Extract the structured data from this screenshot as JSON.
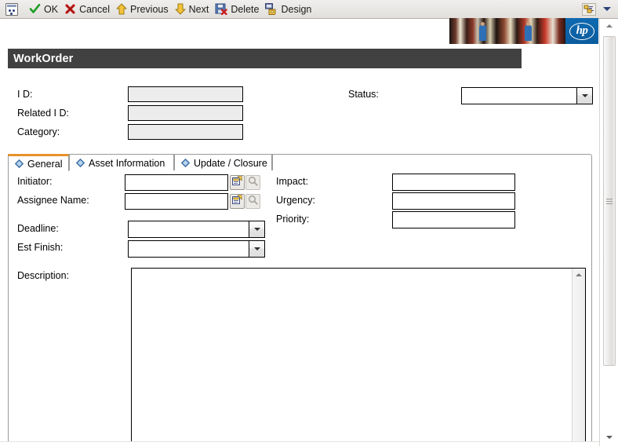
{
  "toolbar": {
    "app_icon": "app-icon",
    "items": [
      {
        "icon": "check-icon",
        "label": "OK"
      },
      {
        "icon": "cancel-icon",
        "label": "Cancel"
      },
      {
        "icon": "arrow-up-icon",
        "label": "Previous"
      },
      {
        "icon": "arrow-down-icon",
        "label": "Next"
      },
      {
        "icon": "delete-icon",
        "label": "Delete"
      },
      {
        "icon": "design-icon",
        "label": "Design"
      }
    ],
    "overflow_icon": "overflow-icon",
    "chevron_icon": "chevron-down-icon"
  },
  "banner": {
    "logo_text": "hp",
    "logo_color": "#0f6ab0"
  },
  "header": {
    "title": "WorkOrder",
    "bar_color": "#414141"
  },
  "top_fields": {
    "id": {
      "label": "I D:",
      "value": "",
      "readonly": true
    },
    "related_id": {
      "label": "Related I D:",
      "value": "",
      "readonly": true
    },
    "category": {
      "label": "Category:",
      "value": "",
      "readonly": true
    },
    "status": {
      "label": "Status:",
      "value": "",
      "placeholder": "",
      "options": []
    }
  },
  "tabs": {
    "active_index": 0,
    "accent_color": "#e8912a",
    "items": [
      {
        "label": "General",
        "icon": "diamond-icon"
      },
      {
        "label": "Asset Information",
        "icon": "diamond-icon"
      },
      {
        "label": "Update / Closure",
        "icon": "diamond-icon"
      }
    ]
  },
  "general_tab": {
    "initiator": {
      "label": "Initiator:",
      "value": "",
      "picker_icon": "picker-icon",
      "search_icon": "search-icon"
    },
    "assignee_name": {
      "label": "Assignee Name:",
      "value": "",
      "picker_icon": "picker-icon",
      "search_icon": "search-icon"
    },
    "deadline": {
      "label": "Deadline:",
      "value": "",
      "options": []
    },
    "est_finish": {
      "label": "Est Finish:",
      "value": "",
      "options": []
    },
    "impact": {
      "label": "Impact:",
      "value": ""
    },
    "urgency": {
      "label": "Urgency:",
      "value": ""
    },
    "priority": {
      "label": "Priority:",
      "value": ""
    },
    "description": {
      "label": "Description:",
      "value": "",
      "placeholder": ""
    }
  },
  "scrollbars": {
    "page_up_icon": "scroll-up-icon",
    "page_down_icon": "scroll-down-icon",
    "textarea_up_icon": "scroll-up-icon"
  }
}
